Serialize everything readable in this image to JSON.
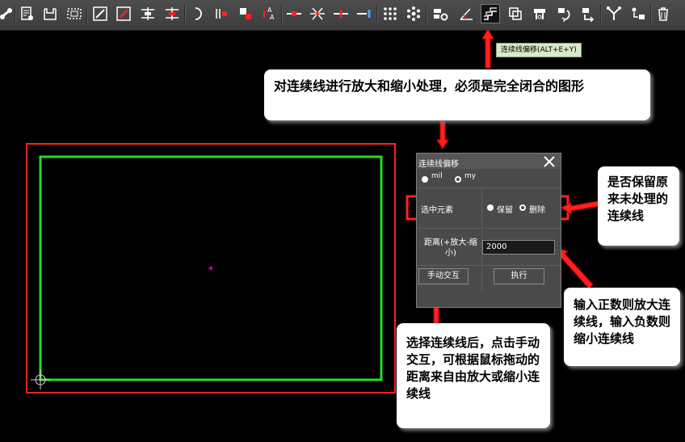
{
  "toolbar": {
    "tooltip": "连续线偏移(ALT+E+Y)",
    "icons": [
      "link-icon",
      "document-settings-icon",
      "save-icon",
      "select-area-icon",
      "edit-shape-icon",
      "edit-shape-red-icon",
      "align-icon",
      "align-red-icon",
      "undo-arc-icon",
      "trim-icon",
      "move-red-icon",
      "text-swap-icon",
      "break-line-icon",
      "cross-icon",
      "node-icon",
      "end-node-icon",
      "dot-grid-icon",
      "snowflake-icon",
      "settings-component-icon",
      "angle-icon",
      "polyline-offset-icon",
      "copy-icon",
      "component-icon",
      "rotate-icon",
      "mirror-icon",
      "tree-icon",
      "flow-icon",
      "delete-icon"
    ]
  },
  "callouts": {
    "main": "对连续线进行放大和缩小处理，必须是完全闭合的图形",
    "keep": "是否保留原来未处理的连续线",
    "input": "输入正数则放大连续线，输入负数则缩小连续线",
    "interactive": "选择连续线后，点击手动交互，可根据鼠标拖动的距离来自由放大或缩小连续线"
  },
  "dialog": {
    "title": "连续线偏移",
    "unit_mil": "mil",
    "unit_my": "my",
    "selected_label": "选中元素",
    "keep_label": "保留",
    "delete_label": "删除",
    "distance_label": "距离(+放大-缩小)",
    "distance_value": "2000",
    "manual_button": "手动交互",
    "execute_button": "执行"
  },
  "colors": {
    "annotation_red": "#ff2020",
    "outline_green": "#20e020",
    "panel_gray": "#4a4a4a"
  }
}
